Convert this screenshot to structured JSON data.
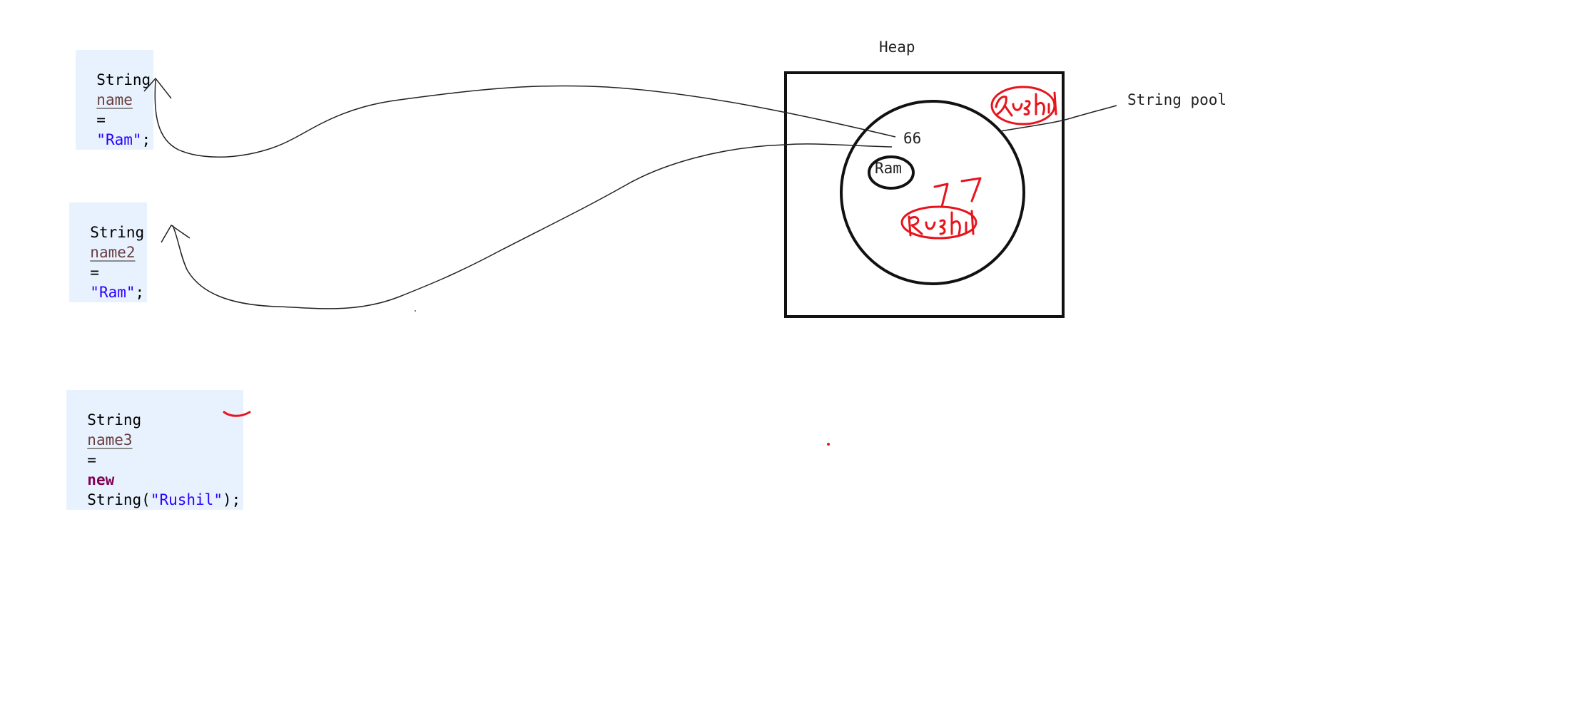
{
  "code": {
    "line1": {
      "type": "String",
      "var": "name",
      "eq": "=",
      "literal": "\"Ram\"",
      "end": ";"
    },
    "line2": {
      "type": "String",
      "var": "name2",
      "eq": "=",
      "literal": "\"Ram\"",
      "end": ";"
    },
    "line3": {
      "type": "String",
      "var": "name3",
      "eq": "=",
      "new_kw": "new",
      "ctor": "String(",
      "literal": "\"Rushil\"",
      "end": ");"
    }
  },
  "diagram": {
    "heap_label": "Heap",
    "pool_label": "String pool",
    "address_label": "66",
    "pool_value": "Ram",
    "handwritten_address": "77",
    "handwritten_value_heap": "Rushil",
    "handwritten_value_pool": "Rushil"
  },
  "colors": {
    "code_bg": "#e8f2fe",
    "string_literal": "#2a00ff",
    "keyword_new": "#7f0055",
    "variable": "#6a3e3e",
    "annotation_red": "#e8141c",
    "line_dark": "#111111"
  }
}
